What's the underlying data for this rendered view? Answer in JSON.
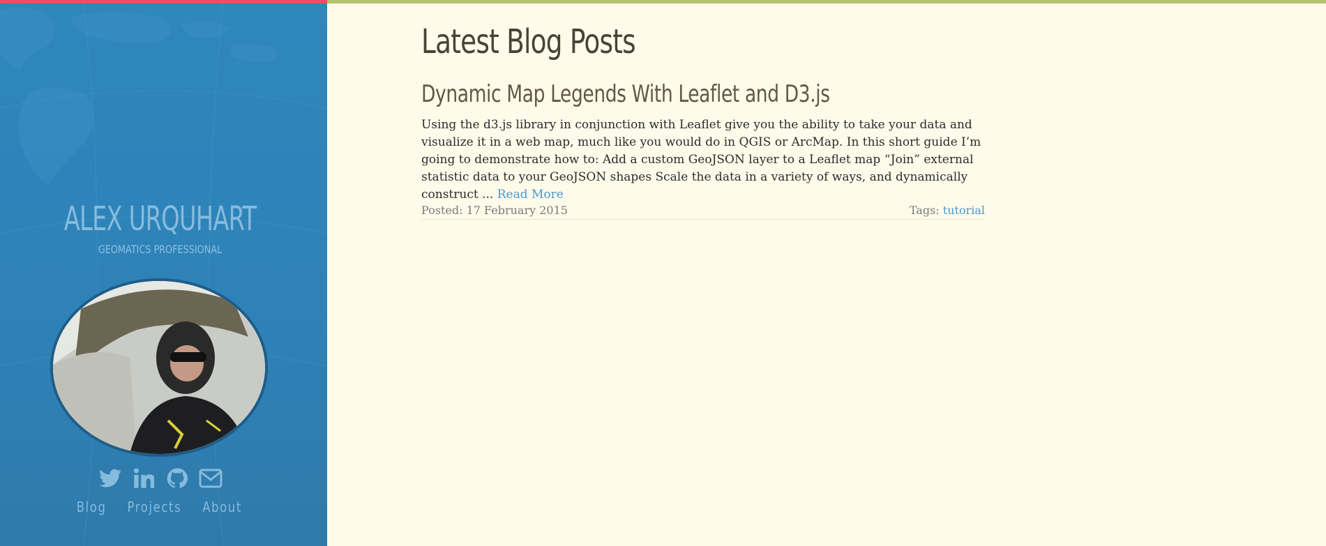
{
  "sidebar": {
    "name": "ALEX URQUHART",
    "subtitle": "GEOMATICS PROFESSIONAL",
    "avatar_alt": "Profile photo",
    "social": [
      {
        "icon": "twitter-icon"
      },
      {
        "icon": "linkedin-icon"
      },
      {
        "icon": "github-icon"
      },
      {
        "icon": "email-icon"
      }
    ],
    "nav": [
      {
        "label": "Blog"
      },
      {
        "label": "Projects"
      },
      {
        "label": "About"
      }
    ]
  },
  "main": {
    "page_title": "Latest Blog Posts",
    "posts": [
      {
        "title": "Dynamic Map Legends With Leaflet and D3.js",
        "excerpt": "Using the d3.js library in conjunction with Leaflet give you the ability to take your data and visualize it in a web map, much like you would do in QGIS or ArcMap. In this short guide I’m going to demonstrate how to: Add a custom GeoJSON layer to a Leaflet map “Join” external statistic data to your GeoJSON shapes Scale the data in a variety of ways, and dynamically construct ...",
        "read_more": "Read More",
        "posted": "Posted: 17 February 2015",
        "tags_label": "Tags:",
        "tag": "tutorial"
      }
    ]
  },
  "colors": {
    "sidebar_bg": "#2f87bc",
    "accent_red": "#e8525a",
    "accent_green": "#b3c46a",
    "link": "#4a97cf",
    "page_bg": "#fffbea"
  }
}
